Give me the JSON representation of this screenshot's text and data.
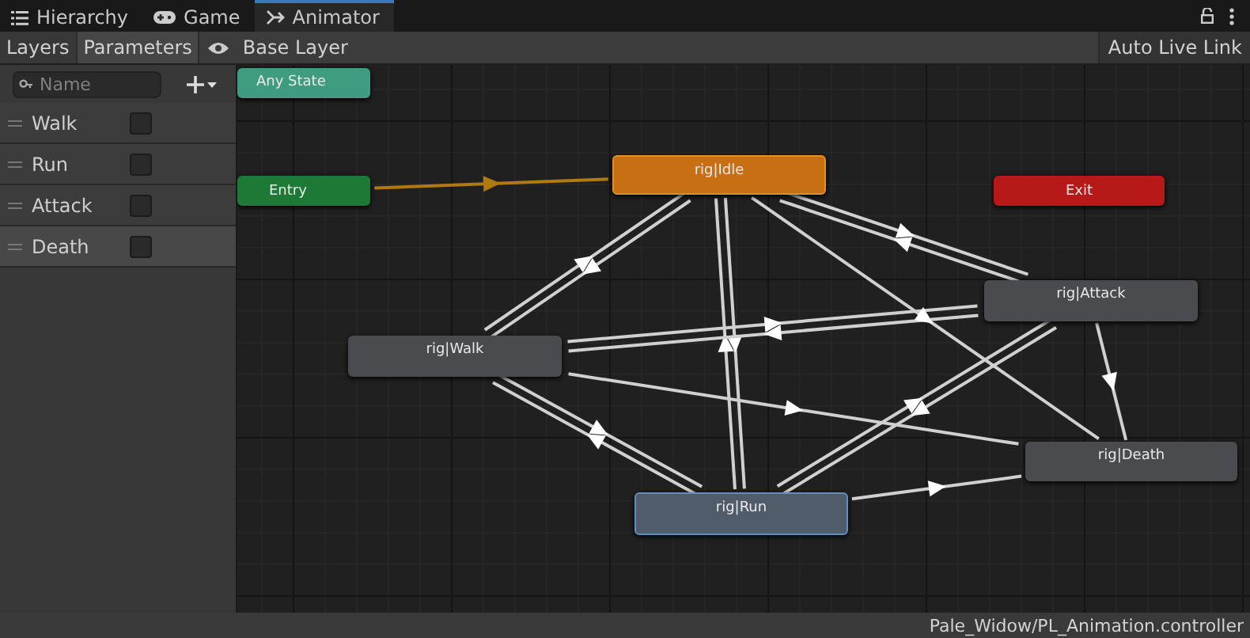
{
  "tabs": [
    {
      "label": "Hierarchy",
      "selected": false
    },
    {
      "label": "Game",
      "selected": false
    },
    {
      "label": "Animator",
      "selected": true
    }
  ],
  "toolbar": {
    "layers_tab": "Layers",
    "parameters_tab": "Parameters",
    "breadcrumb": "Base Layer",
    "auto_live_link": "Auto Live Link"
  },
  "search": {
    "placeholder": "Name"
  },
  "parameters": [
    {
      "name": "Walk",
      "checked": false,
      "selected": false
    },
    {
      "name": "Run",
      "checked": false,
      "selected": false
    },
    {
      "name": "Attack",
      "checked": false,
      "selected": false
    },
    {
      "name": "Death",
      "checked": false,
      "selected": true
    }
  ],
  "states": [
    {
      "label": "Any State",
      "kind": "any",
      "selected": false
    },
    {
      "label": "Entry",
      "kind": "entry",
      "selected": false
    },
    {
      "label": "rig|Idle",
      "kind": "default",
      "selected": false
    },
    {
      "label": "Exit",
      "kind": "exit",
      "selected": false
    },
    {
      "label": "rig|Attack",
      "kind": "state",
      "selected": false
    },
    {
      "label": "rig|Walk",
      "kind": "state",
      "selected": false
    },
    {
      "label": "rig|Death",
      "kind": "state",
      "selected": false
    },
    {
      "label": "rig|Run",
      "kind": "state",
      "selected": true
    }
  ],
  "status_bar": "Pale_Widow/PL_Animation.controller"
}
